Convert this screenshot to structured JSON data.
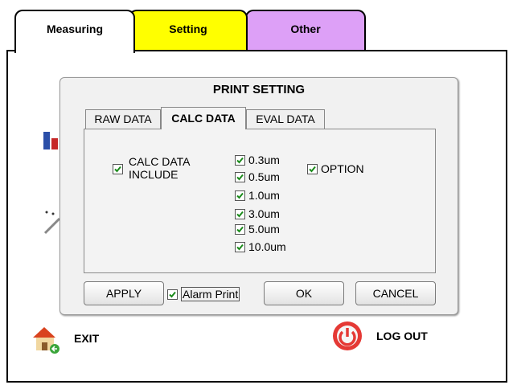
{
  "tabs": [
    {
      "label": "Measuring",
      "color": "#ffffff"
    },
    {
      "label": "Setting",
      "color": "#ffff00"
    },
    {
      "label": "Other",
      "color": "#dda0f7"
    }
  ],
  "dialog": {
    "title": "PRINT SETTING",
    "tabs": [
      "RAW DATA",
      "CALC DATA",
      "EVAL DATA"
    ],
    "active_tab": "CALC DATA",
    "calc_include": {
      "label_line1": "CALC DATA",
      "label_line2": "INCLUDE",
      "checked": true
    },
    "sizes": [
      {
        "label": "0.3um",
        "checked": true
      },
      {
        "label": "0.5um",
        "checked": true
      },
      {
        "label": "1.0um",
        "checked": true
      },
      {
        "label": "3.0um",
        "checked": true
      },
      {
        "label": "5.0um",
        "checked": true
      },
      {
        "label": "10.0um",
        "checked": true
      }
    ],
    "option": {
      "label": "OPTION",
      "checked": true
    },
    "buttons": {
      "apply": "APPLY",
      "ok": "OK",
      "cancel": "CANCEL"
    },
    "alarm_print": {
      "label": "Alarm Print",
      "checked": true
    }
  },
  "bottom": {
    "exit_label": "EXIT",
    "logout_label": "LOG OUT"
  },
  "icons": {
    "check": "check-icon",
    "home": "home-exit-icon",
    "power": "power-icon"
  }
}
